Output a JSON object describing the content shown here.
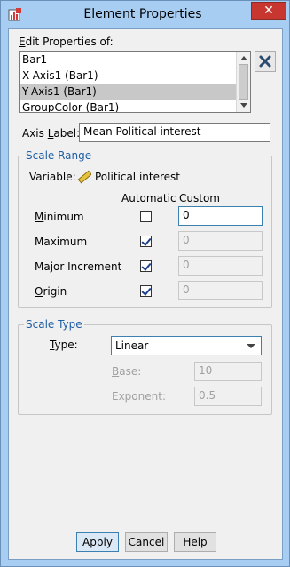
{
  "window": {
    "title": "Element Properties"
  },
  "edit_props": {
    "label_prefix": "E",
    "label_rest": "dit Properties of:",
    "items": [
      {
        "label": "Bar1",
        "selected": false
      },
      {
        "label": "X-Axis1 (Bar1)",
        "selected": false
      },
      {
        "label": "Y-Axis1 (Bar1)",
        "selected": true
      },
      {
        "label": "GroupColor (Bar1)",
        "selected": false
      }
    ]
  },
  "axis_label": {
    "label_prefix": "Axis ",
    "label_u": "L",
    "label_rest": "abel:",
    "value": "Mean Political interest"
  },
  "scale_range": {
    "title": "Scale Range",
    "variable_label": "Variable:",
    "variable_name": "Political interest",
    "automatic_header": "Automatic",
    "custom_header": "Custom",
    "rows": [
      {
        "label_u": "M",
        "label_rest": "inimum",
        "automatic": false,
        "custom": "0"
      },
      {
        "label_u": "",
        "label_rest": "Maximum",
        "label_u2": "x",
        "automatic": true,
        "custom": "0"
      },
      {
        "label_u": "",
        "label_rest": "Major Increment",
        "automatic": true,
        "custom": "0"
      },
      {
        "label_u": "O",
        "label_rest": "rigin",
        "automatic": true,
        "custom": "0"
      }
    ]
  },
  "scale_type": {
    "title": "Scale Type",
    "type_label_u": "T",
    "type_label_rest": "ype:",
    "type_value": "Linear",
    "base_label_u": "B",
    "base_label_rest": "ase:",
    "base_value": "10",
    "exponent_label_rest": "Exponent:",
    "exponent_value": "0.5"
  },
  "buttons": {
    "apply_u": "A",
    "apply_rest": "pply",
    "cancel": "Cancel",
    "help": "Help"
  },
  "colors": {
    "accent": "#1f5fa6",
    "titlebar": "#a8cdf2",
    "close": "#c7372f"
  }
}
